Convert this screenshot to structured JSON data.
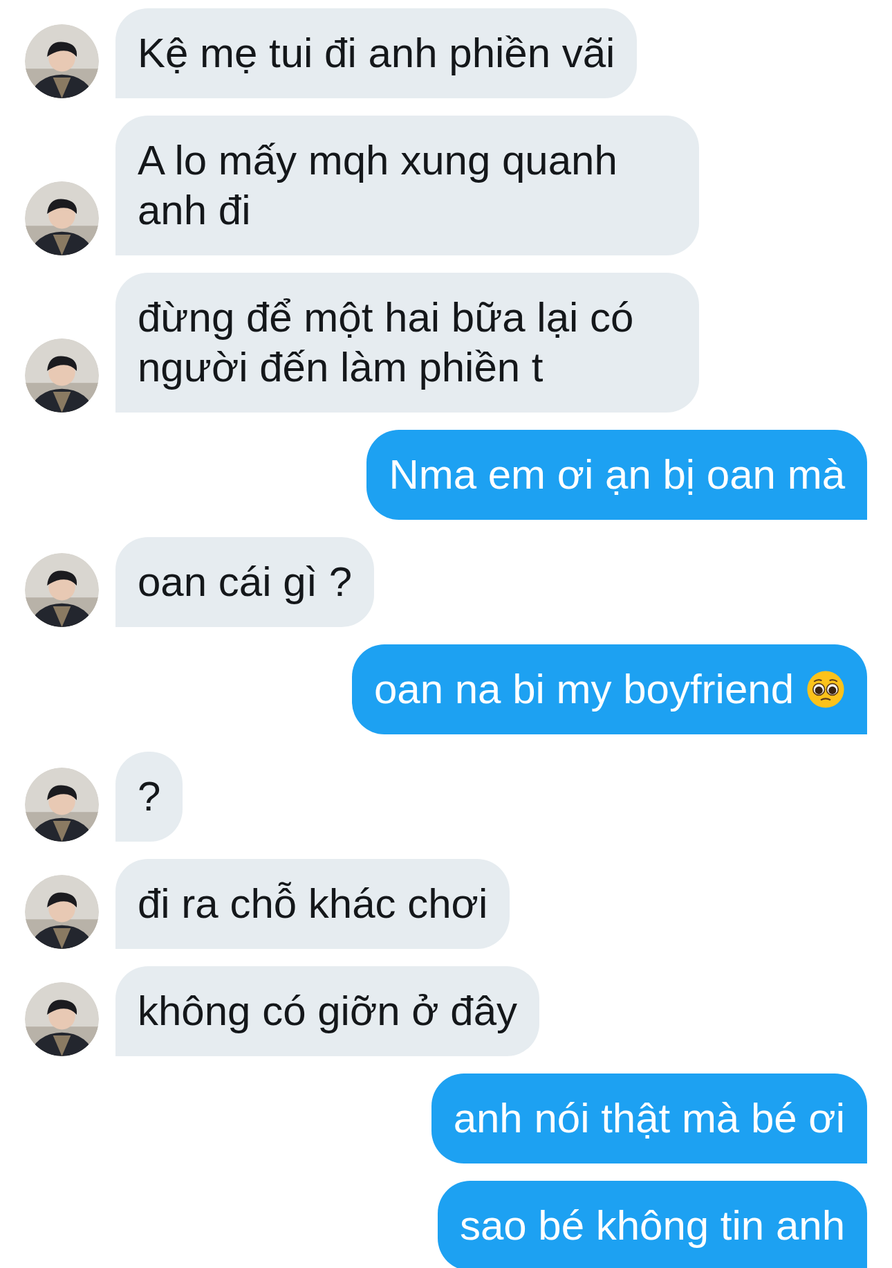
{
  "messages": [
    {
      "kind": "received",
      "text": "Kệ mẹ tui đi anh phiền vãi"
    },
    {
      "kind": "received",
      "text": "A lo mấy mqh xung quanh anh đi"
    },
    {
      "kind": "received",
      "text": "đừng để một hai bữa lại có người đến làm phiền t"
    },
    {
      "kind": "sent",
      "text": "Nma em ơi ạn bị oan mà"
    },
    {
      "kind": "received",
      "text": "oan cái gì ?"
    },
    {
      "kind": "sent",
      "text": "oan na bi my boyfriend",
      "emoji": true
    },
    {
      "kind": "received",
      "text": "?"
    },
    {
      "kind": "received",
      "text": "đi ra chỗ khác chơi"
    },
    {
      "kind": "received",
      "text": "không có giỡn ở đây"
    },
    {
      "kind": "sent",
      "text": "anh nói thật mà bé ơi"
    },
    {
      "kind": "sent",
      "text": "sao bé không tin anh"
    }
  ]
}
